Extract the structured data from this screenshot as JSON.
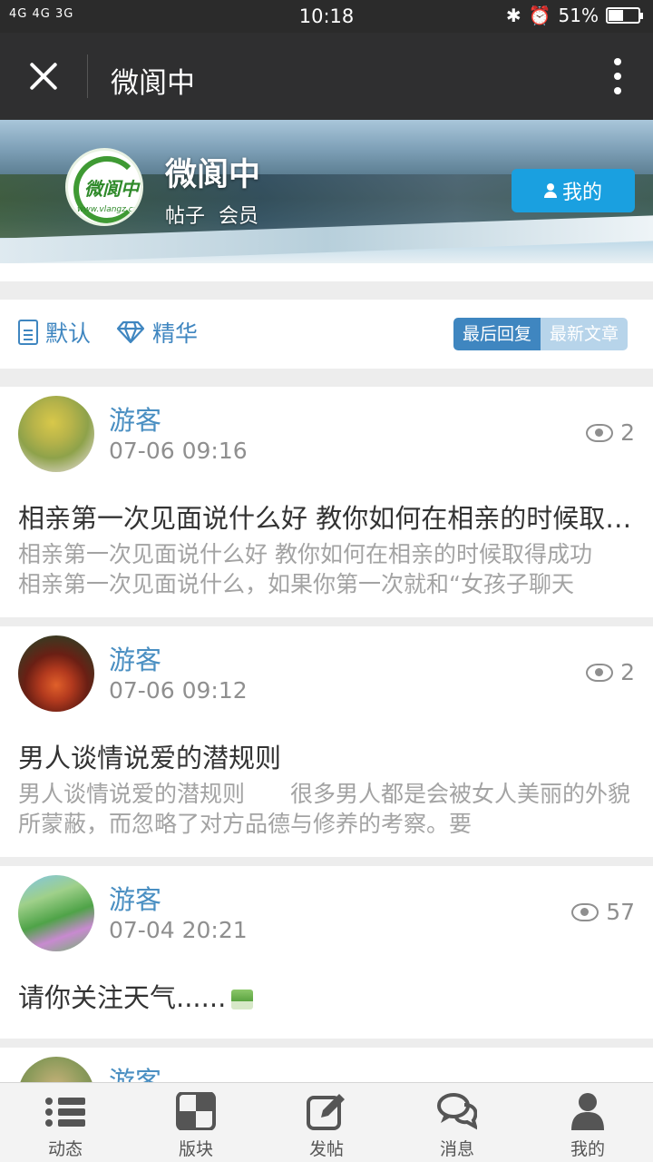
{
  "status_bar": {
    "network": "4G 4G 3G",
    "time": "10:18",
    "battery_percent": "51%",
    "battery_level": 0.51
  },
  "nav": {
    "title": "微阆中"
  },
  "header": {
    "logo_text": "微阆中",
    "logo_url": "www.vlangz.cn",
    "forum_name": "微阆中",
    "meta_posts": "帖子",
    "meta_members": "会员",
    "my_button": "我的"
  },
  "tabs": {
    "default_label": "默认",
    "featured_label": "精华",
    "sort_last_reply": "最后回复",
    "sort_newest": "最新文章"
  },
  "posts": [
    {
      "user": "游客",
      "time": "07-06 09:16",
      "views": "2",
      "title": "相亲第一次见面说什么好 教你如何在相亲的时候取得成功",
      "excerpt": "相亲第一次见面说什么好 教你如何在相亲的时候取得成功　　相亲第一次见面说什么，如果你第一次就和“女孩子聊天"
    },
    {
      "user": "游客",
      "time": "07-06 09:12",
      "views": "2",
      "title": "男人谈情说爱的潜规则",
      "excerpt": "男人谈情说爱的潜规则　　很多男人都是会被女人美丽的外貌所蒙蔽，而忽略了对方品德与修养的考察。要"
    },
    {
      "user": "游客",
      "time": "07-04 20:21",
      "views": "57",
      "title": "请你关注天气......"
    },
    {
      "user": "游客"
    }
  ],
  "tabbar": {
    "items": [
      "动态",
      "版块",
      "发帖",
      "消息",
      "我的"
    ]
  }
}
